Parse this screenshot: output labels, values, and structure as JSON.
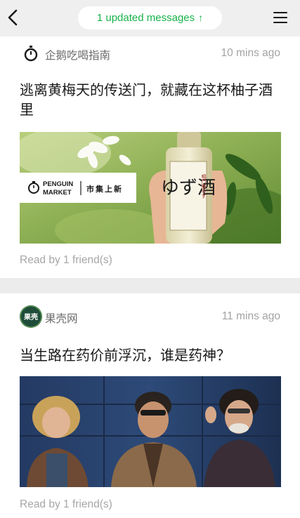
{
  "header": {
    "updates_label": "1 updated messages",
    "updates_arrow": "↑"
  },
  "feed": [
    {
      "source": "企鹅吃喝指南",
      "time": "10 mins ago",
      "title": "逃离黄梅天的传送门，就藏在这杯柚子酒里",
      "image": {
        "banner_brand_line1": "PENGUIN",
        "banner_brand_line2": "MARKET",
        "banner_tag": "市集上新",
        "bottle_label": "ゆず酒",
        "bottle_sublabel": "鳴門鯛ゆず"
      },
      "read_by": "Read by 1 friend(s)"
    },
    {
      "source": "果壳网",
      "source_badge": "果壳",
      "time": "11 mins ago",
      "title": "当生路在药价前浮沉，谁是药神？",
      "read_by": "Read by 1 friend(s)"
    }
  ],
  "colors": {
    "accent_green": "#17b34a",
    "page_bg": "#ececec",
    "guokr_badge": "#1f4d3a"
  }
}
